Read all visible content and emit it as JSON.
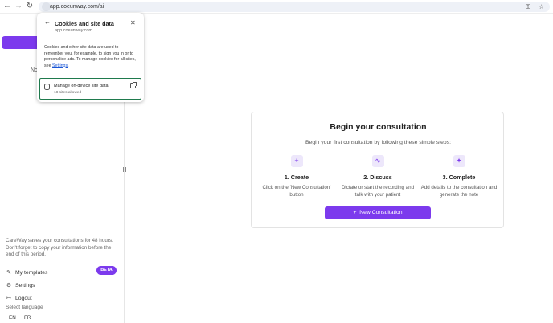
{
  "browser": {
    "back_icon": "back-arrow-icon",
    "forward_icon": "forward-arrow-icon",
    "reload_icon": "reload-icon",
    "url": "app.coeunway.com/ai"
  },
  "popup": {
    "title": "Cookies and site data",
    "domain": "app.coeunway.com",
    "description": "Cookies and other site data are used to remember you, for example, to sign you in or to personalise ads. To manage cookies for all sites, see ",
    "settings_link": "Settings",
    "description_end": ".",
    "manage": {
      "title": "Manage on-device site data",
      "subtitle": "18 sites allowed"
    }
  },
  "sidebar": {
    "partial_text": "No",
    "save_info": "CareWay saves your consultations for 48 hours. Don't forget to copy your information before the end of this period.",
    "items": [
      {
        "label": "My templates",
        "icon": "template-icon"
      },
      {
        "label": "Settings",
        "icon": "gear-icon"
      },
      {
        "label": "Logout",
        "icon": "logout-icon"
      }
    ],
    "beta_badge": "BETA",
    "language_label": "Select language",
    "languages": [
      "EN",
      "FR"
    ]
  },
  "main": {
    "title": "Begin your consultation",
    "subtitle": "Begin your first consultation by following these simple steps:",
    "steps": [
      {
        "title": "1. Create",
        "text": "Click on the 'New Consultation' button",
        "icon": "plus-icon"
      },
      {
        "title": "2. Discuss",
        "text": "Dictate or start the recording and talk with your patient",
        "icon": "audio-wave-icon"
      },
      {
        "title": "3. Complete",
        "text": "Add details to the consultation and generate the note",
        "icon": "sparkle-icon"
      }
    ],
    "new_button": "New Consultation",
    "accent_color": "#7c3aed"
  }
}
